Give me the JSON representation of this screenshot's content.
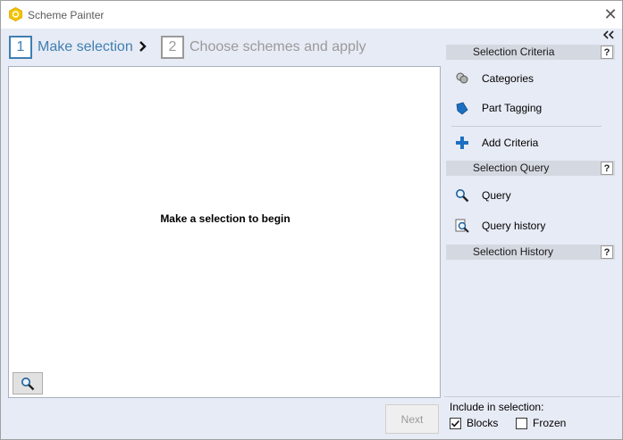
{
  "window": {
    "title": "Scheme Painter",
    "close_glyph": "✕"
  },
  "wizard": {
    "steps": [
      {
        "number": "1",
        "label": "Make selection",
        "active": true
      },
      {
        "number": "2",
        "label": "Choose schemes and apply",
        "active": false
      }
    ]
  },
  "canvas": {
    "message": "Make a selection to begin"
  },
  "footer": {
    "next_label": "Next"
  },
  "panel": {
    "sections": [
      {
        "title": "Selection Criteria",
        "help": "?"
      },
      {
        "title": "Selection Query",
        "help": "?"
      },
      {
        "title": "Selection History",
        "help": "?"
      }
    ],
    "criteria_items": [
      {
        "label": "Categories",
        "icon": "categories-icon"
      },
      {
        "label": "Part Tagging",
        "icon": "tag-icon"
      },
      {
        "label": "Add Criteria",
        "icon": "plus-icon"
      }
    ],
    "query_items": [
      {
        "label": "Query",
        "icon": "search-icon"
      },
      {
        "label": "Query history",
        "icon": "query-history-icon"
      }
    ],
    "include": {
      "label": "Include in selection:",
      "options": [
        {
          "label": "Blocks",
          "checked": true
        },
        {
          "label": "Frozen",
          "checked": false
        }
      ]
    }
  },
  "colors": {
    "accent": "#3f7fb1",
    "inactive": "#9a9a9a",
    "background": "#e7ebf5",
    "section_header": "#d4d8e1"
  }
}
